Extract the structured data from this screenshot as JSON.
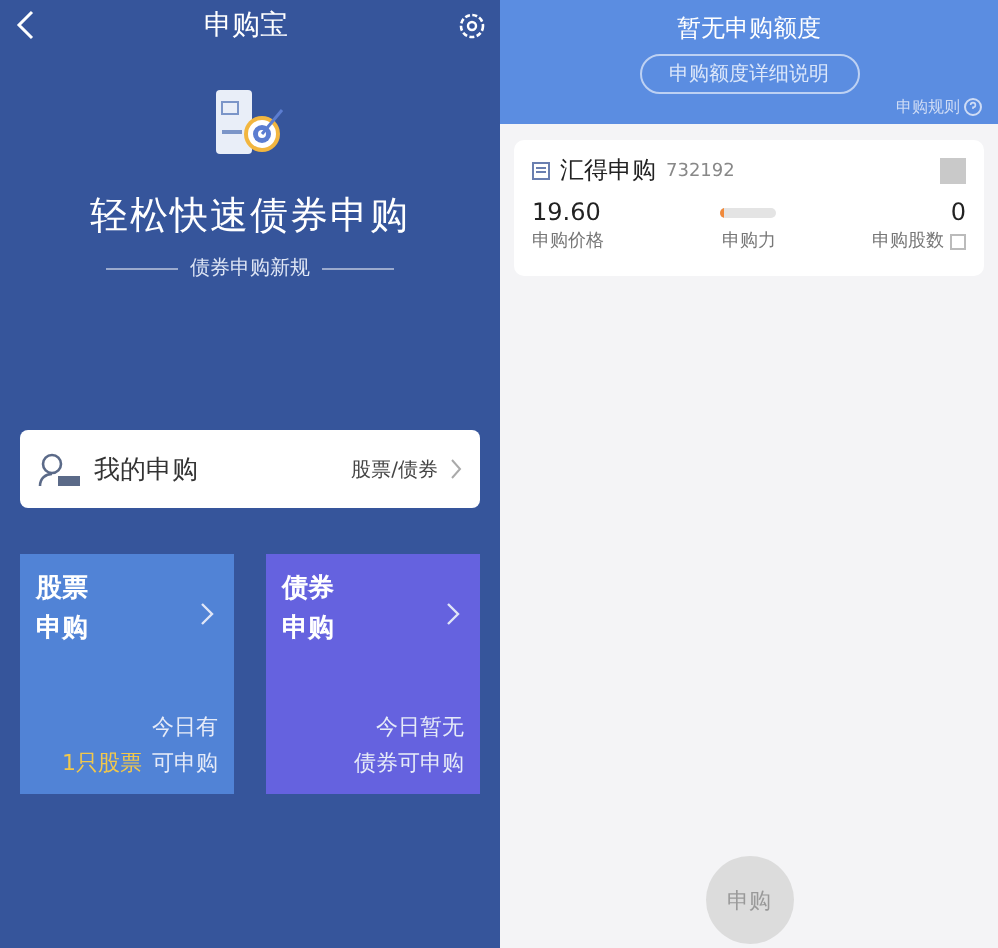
{
  "left_screen": {
    "nav_title": "申购宝",
    "hero": {
      "title": "轻松快速债券申购",
      "subtitle": "债券申购新规"
    },
    "my_subscription": {
      "label": "我的申购",
      "filter": "股票/债券"
    },
    "tiles": [
      {
        "title_lines": [
          "股票",
          "申购"
        ],
        "color": "#5183d6",
        "note_lines": [
          [
            {
              "text": "今日有",
              "highlight": false
            }
          ],
          [
            {
              "text": "1只股票",
              "highlight": true
            },
            {
              "text": "可申购",
              "highlight": false
            }
          ]
        ]
      },
      {
        "title_lines": [
          "债券",
          "申购"
        ],
        "color": "#6562df",
        "note_lines": [
          [
            {
              "text": "今日暂无",
              "highlight": false
            }
          ],
          [
            {
              "text": "债券可申购",
              "highlight": false
            }
          ]
        ]
      }
    ]
  },
  "right_screen": {
    "header": {
      "title": "暂无申购额度",
      "detail_button": "申购额度详细说明",
      "rules_link": "申购规则"
    },
    "card": {
      "name": "汇得申购",
      "code": "732192",
      "price": "19.60",
      "price_label": "申购价格",
      "power": {
        "level": 0.05,
        "label": "申购力"
      },
      "shares": "0",
      "shares_label": "申购股数"
    },
    "submit": {
      "label": "申购",
      "disabled": true
    }
  }
}
